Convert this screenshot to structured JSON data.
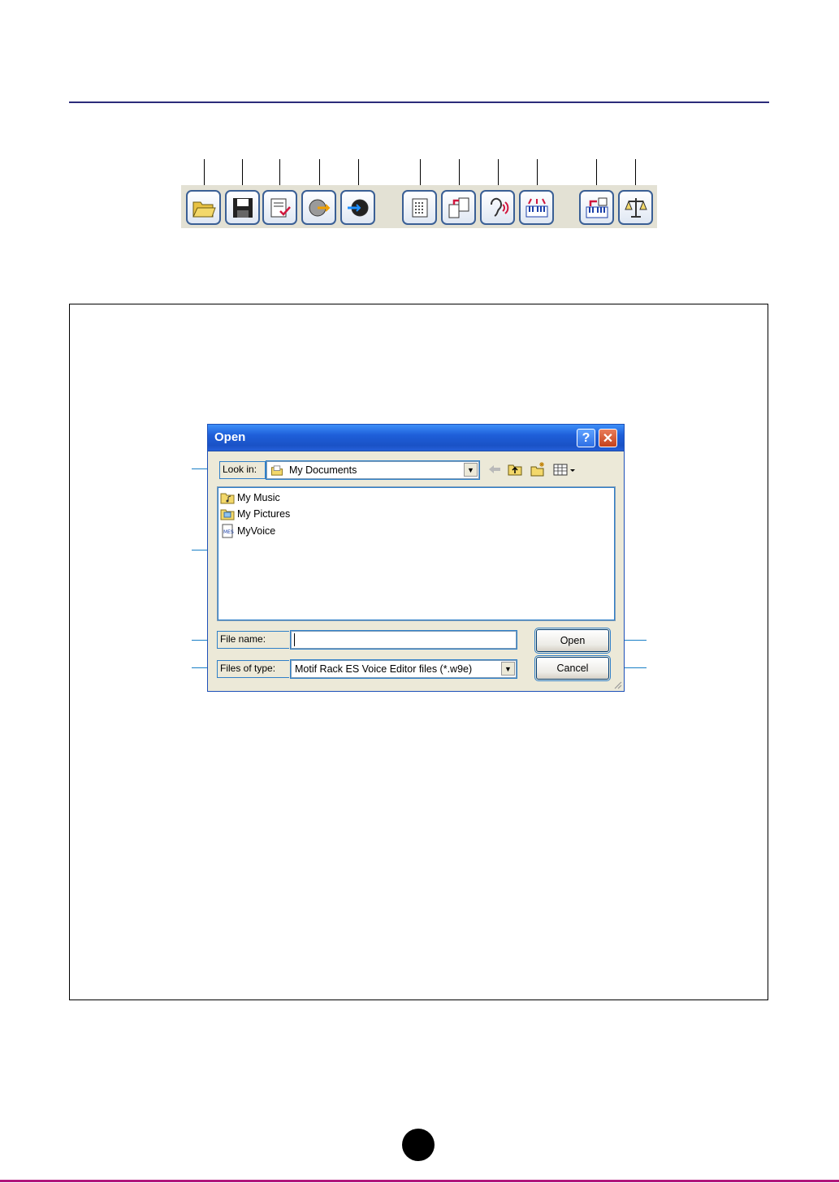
{
  "toolbar": {
    "buttons": [
      {
        "name": "open-file"
      },
      {
        "name": "save-file"
      },
      {
        "name": "voice-list"
      },
      {
        "name": "receive"
      },
      {
        "name": "transmit"
      },
      {
        "name": "library"
      },
      {
        "name": "copy"
      },
      {
        "name": "audition"
      },
      {
        "name": "keyboard"
      },
      {
        "name": "bulk-send"
      },
      {
        "name": "compare"
      }
    ]
  },
  "dialog": {
    "title": "Open",
    "help_label": "?",
    "close_label": "✕",
    "look_in_label": "Look in:",
    "look_in_value": "My Documents",
    "files": [
      {
        "name": "My Music",
        "icon": "music-folder-icon"
      },
      {
        "name": "My Pictures",
        "icon": "pictures-folder-icon"
      },
      {
        "name": "MyVoice",
        "icon": "mes-file-icon"
      }
    ],
    "file_name_label": "File name:",
    "file_name_value": "",
    "files_of_type_label": "Files of type:",
    "files_of_type_value": "Motif Rack ES Voice Editor files (*.w9e)",
    "open_button": "Open",
    "cancel_button": "Cancel"
  },
  "colors": {
    "title_bar": "#1e5fd9",
    "callout_blue": "#1a7fc6",
    "rule_navy": "#2b2b7a",
    "bottom_rule": "#b0157a"
  }
}
